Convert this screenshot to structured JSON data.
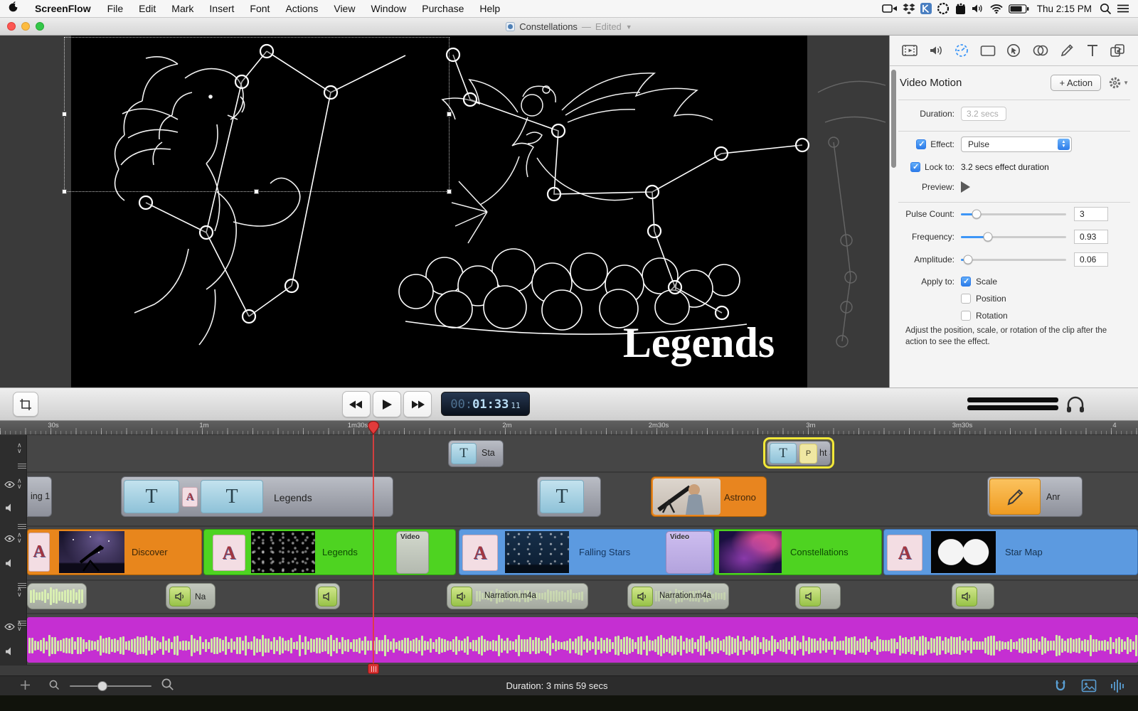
{
  "menu_bar": {
    "app_name": "ScreenFlow",
    "menus": [
      "File",
      "Edit",
      "Mark",
      "Insert",
      "Font",
      "Actions",
      "View",
      "Window",
      "Purchase",
      "Help"
    ],
    "clock": "Thu 2:15 PM"
  },
  "title_bar": {
    "title": "Constellations",
    "separator": "—",
    "state": "Edited"
  },
  "canvas": {
    "title_overlay": "Legends"
  },
  "inspector": {
    "title": "Video Motion",
    "action_button": "+ Action",
    "duration": {
      "label": "Duration:",
      "value": "3.2 secs"
    },
    "effect": {
      "label": "Effect:",
      "value": "Pulse",
      "checked": true
    },
    "lock": {
      "label": "Lock to:",
      "value": "3.2 secs effect duration",
      "checked": true
    },
    "preview_label": "Preview:",
    "sliders": [
      {
        "label": "Pulse Count:",
        "value": "3",
        "percent": 15
      },
      {
        "label": "Frequency:",
        "value": "0.93",
        "percent": 26
      },
      {
        "label": "Amplitude:",
        "value": "0.06",
        "percent": 7
      }
    ],
    "apply_to": {
      "label": "Apply to:",
      "options": [
        {
          "label": "Scale",
          "checked": true
        },
        {
          "label": "Position",
          "checked": false
        },
        {
          "label": "Rotation",
          "checked": false
        }
      ]
    },
    "help_text": "Adjust the position, scale, or rotation of the clip after the action to see the effect."
  },
  "transport": {
    "timecode": {
      "hours": "00:",
      "minsec": "01:33",
      "frames": "11"
    }
  },
  "timeline": {
    "ruler": [
      "30s",
      "1m",
      "1m30s",
      "2m",
      "2m30s",
      "3m",
      "3m30s",
      "4"
    ],
    "glyphs": {
      "text": "T",
      "transition": "A"
    },
    "clips": {
      "sta": "Sta",
      "selected_badge": "P",
      "selected_label": "ht S",
      "ing1": "ing 1",
      "legends_text": "Legends",
      "astrono": "Astrono",
      "anr": "Anr",
      "discover": "Discover",
      "legends_video": "Legends",
      "video_tag_1": "Video",
      "falling_stars": "Falling Stars",
      "video_tag_2": "Video",
      "constellations": "Constellations",
      "star_map": "Star Map",
      "na": "Na",
      "narration_1": "Narration.m4a",
      "narration_2": "Narration.m4a"
    }
  },
  "status_bar": {
    "duration": "Duration: 3 mins 59 secs"
  },
  "colors": {
    "accent_blue": "#3d96f7",
    "selection_yellow": "#f2e838",
    "clip_orange": "#e8861c",
    "clip_green": "#4ed321",
    "clip_blue": "#5c9ae0",
    "clip_magenta": "#c52fd2"
  }
}
